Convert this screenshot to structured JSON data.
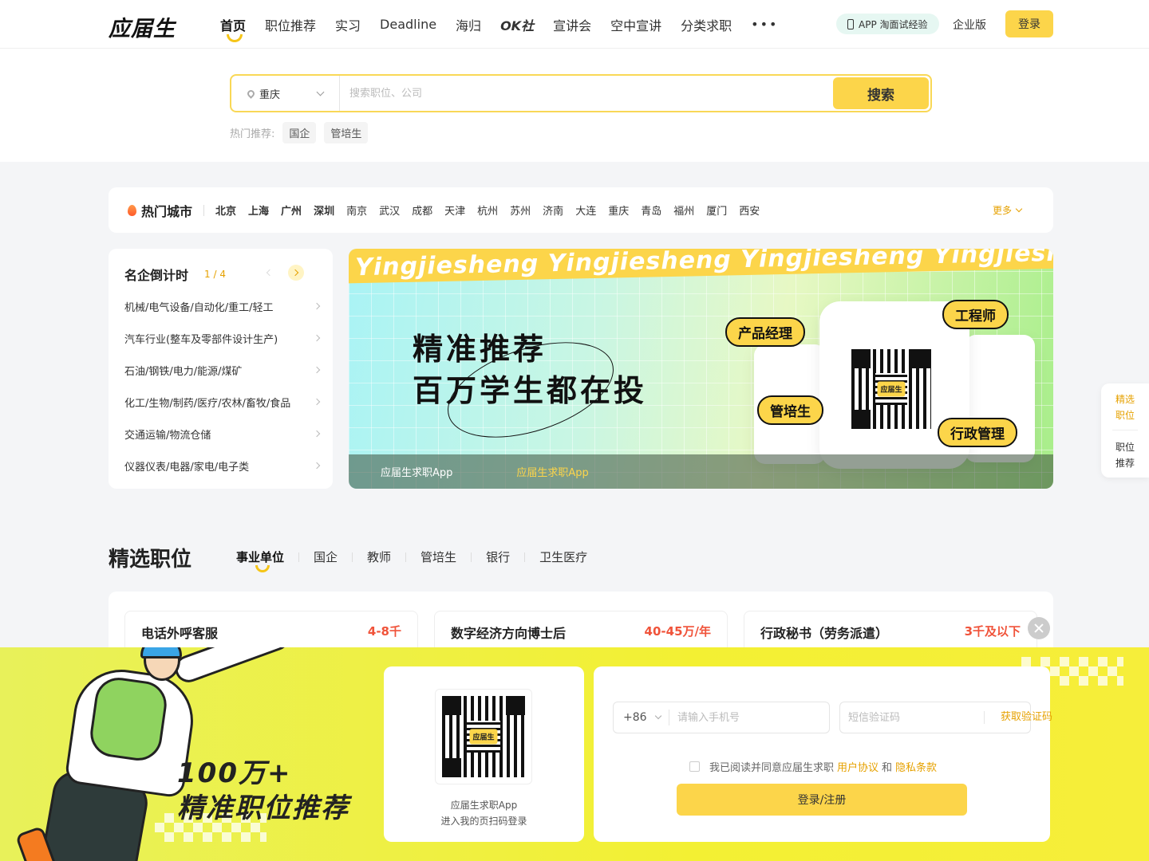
{
  "header": {
    "logo": "应届生",
    "nav": [
      "首页",
      "职位推荐",
      "实习",
      "Deadline",
      "海归",
      "OK社",
      "宣讲会",
      "空中宣讲",
      "分类求职"
    ],
    "more": "•••",
    "app_pill": "APP 淘面试经验",
    "enterprise": "企业版",
    "login": "登录"
  },
  "search": {
    "city": "重庆",
    "placeholder": "搜索职位、公司",
    "button": "搜索",
    "hot_label": "热门推荐:",
    "hot_tags": [
      "国企",
      "管培生"
    ]
  },
  "hot_cities": {
    "title": "热门城市",
    "cities_bold": [
      "北京",
      "上海",
      "广州",
      "深圳"
    ],
    "cities": [
      "南京",
      "武汉",
      "成都",
      "天津",
      "杭州",
      "苏州",
      "济南",
      "大连",
      "重庆",
      "青岛",
      "福州",
      "厦门",
      "西安"
    ],
    "more": "更多"
  },
  "countdown": {
    "title": "名企倒计时",
    "pager": "1 / 4",
    "categories": [
      "机械/电气设备/自动化/重工/轻工",
      "汽车行业(整车及零部件设计生产)",
      "石油/钢铁/电力/能源/煤矿",
      "化工/生物/制药/医疗/农林/畜牧/食品",
      "交通运输/物流仓储",
      "仪器仪表/电器/家电/电子类"
    ]
  },
  "banner": {
    "strip_text": "Yingjiesheng Yingjiesheng Yingjiesheng Yingjiesheng Yin",
    "headline_1": "精准推荐",
    "headline_2": "百万学生都在投",
    "qr_logo": "应届生",
    "bubbles": [
      "产品经理",
      "工程师",
      "管培生",
      "行政管理"
    ],
    "tabs": [
      "应届生求职App",
      "应届生求职App"
    ]
  },
  "side_widget": {
    "item_1": "精选职位",
    "item_2": "职位推荐"
  },
  "jobs": {
    "title": "精选职位",
    "tabs": [
      "事业单位",
      "国企",
      "教师",
      "管培生",
      "银行",
      "卫生医疗"
    ],
    "cards": [
      {
        "name": "电话外呼客服",
        "salary": "4-8千"
      },
      {
        "name": "数字经济方向博士后",
        "salary": "40-45万/年"
      },
      {
        "name": "行政秘书（劳务派遣）",
        "salary": "3千及以下"
      }
    ]
  },
  "login_overlay": {
    "promo_line_1": "100万+",
    "promo_line_2": "精准职位推荐",
    "qr_logo": "应届生",
    "qr_caption_1": "应届生求职App",
    "qr_caption_2": "进入我的页扫码登录",
    "country_code": "+86",
    "phone_placeholder": "请输入手机号",
    "code_placeholder": "短信验证码",
    "get_code": "获取验证码",
    "agree_prefix": "我已阅读并同意应届生求职",
    "agree_link_1": "用户协议",
    "agree_and": "和",
    "agree_link_2": "隐私条款",
    "submit": "登录/注册"
  },
  "colors": {
    "accent": "#fcd54a",
    "link": "#e6a100",
    "salary": "#f0533a"
  }
}
